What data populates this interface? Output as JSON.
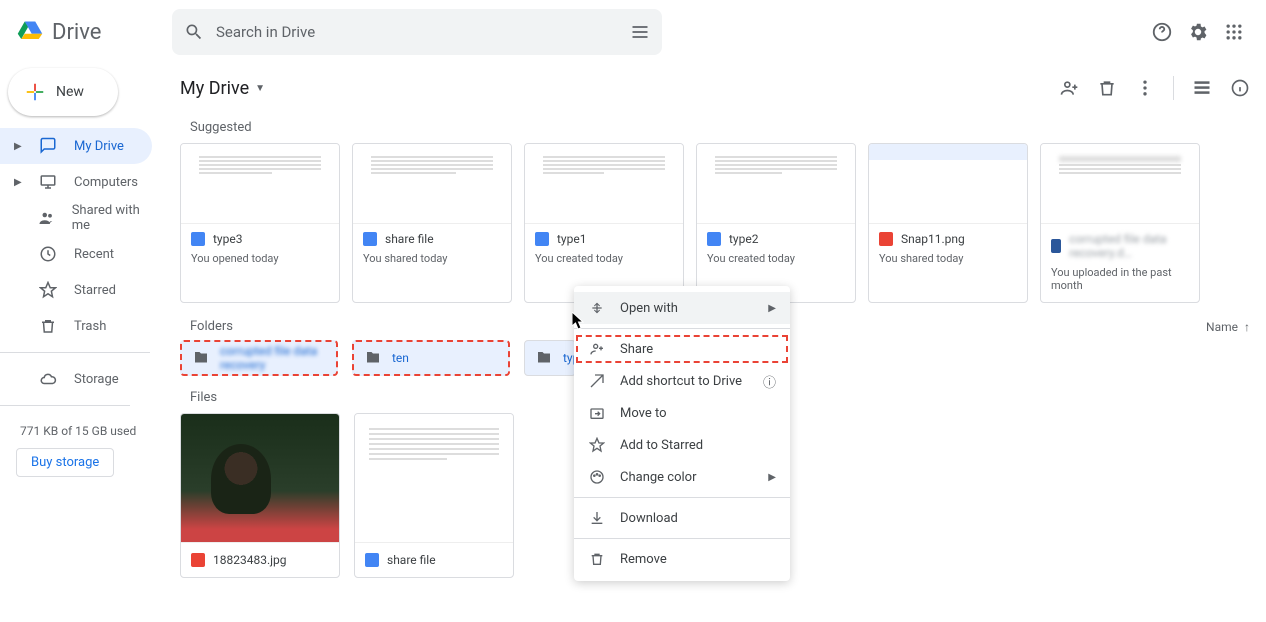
{
  "header": {
    "app_name": "Drive",
    "search_placeholder": "Search in Drive"
  },
  "sidebar": {
    "new_label": "New",
    "items": [
      {
        "label": "My Drive"
      },
      {
        "label": "Computers"
      },
      {
        "label": "Shared with me"
      },
      {
        "label": "Recent"
      },
      {
        "label": "Starred"
      },
      {
        "label": "Trash"
      },
      {
        "label": "Storage"
      }
    ],
    "storage_used": "771 KB of 15 GB used",
    "buy_label": "Buy storage"
  },
  "main": {
    "breadcrumb": "My Drive",
    "suggested_label": "Suggested",
    "suggested": [
      {
        "name": "type3",
        "sub": "You opened today",
        "icon": "blue"
      },
      {
        "name": "share file",
        "sub": "You shared today",
        "icon": "blue"
      },
      {
        "name": "type1",
        "sub": "You created today",
        "icon": "blue"
      },
      {
        "name": "type2",
        "sub": "You created today",
        "icon": "blue"
      },
      {
        "name": "Snap11.png",
        "sub": "You shared today",
        "icon": "red"
      },
      {
        "name": "corrupted file data recovery.d…",
        "sub": "You uploaded in the past month",
        "icon": "bluedoc"
      }
    ],
    "folders_label": "Folders",
    "sort_label": "Name",
    "folders": [
      {
        "name": "corrupted file data recovery"
      },
      {
        "name": "ten"
      },
      {
        "name": "typ"
      }
    ],
    "files_label": "Files",
    "files": [
      {
        "name": "18823483.jpg",
        "icon": "red",
        "kind": "img"
      },
      {
        "name": "share file",
        "icon": "blue",
        "kind": "doc"
      }
    ]
  },
  "context_menu": {
    "open_with": "Open with",
    "share": "Share",
    "add_shortcut": "Add shortcut to Drive",
    "move_to": "Move to",
    "add_starred": "Add to Starred",
    "change_color": "Change color",
    "download": "Download",
    "remove": "Remove"
  }
}
